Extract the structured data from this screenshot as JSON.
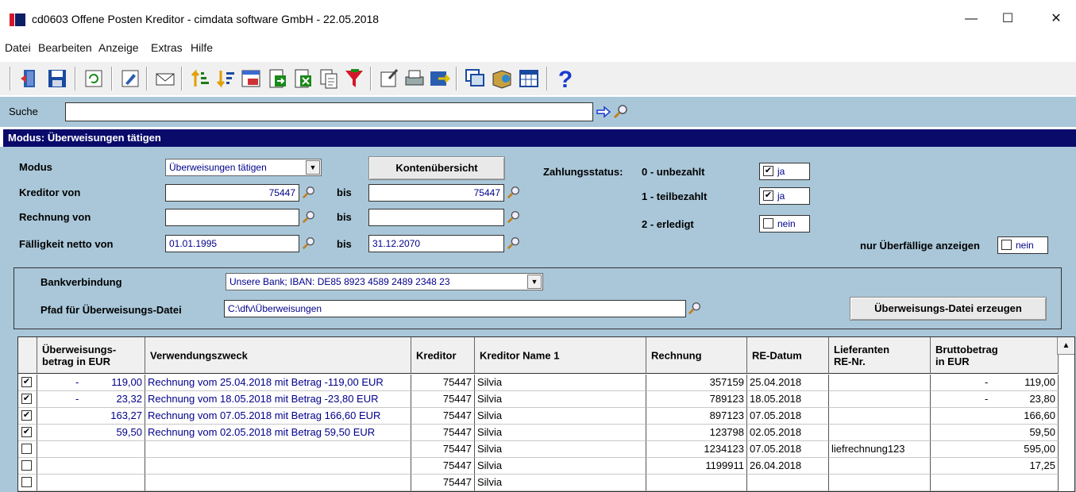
{
  "window": {
    "title": "cd0603 Offene Posten Kreditor - cimdata software GmbH - 22.05.2018",
    "minimize": "—",
    "maximize": "☐",
    "close": "✕"
  },
  "menu": {
    "items": [
      "Datei",
      "Bearbeiten",
      "Anzeige",
      "Extras",
      "Hilfe"
    ]
  },
  "toolbar": {
    "icons": [
      "exit-icon",
      "save-icon",
      "refresh-icon",
      "edit-icon",
      "mail-icon",
      "sort-asc-icon",
      "sort-desc-icon",
      "calendar-icon",
      "export-icon",
      "excel-icon",
      "copy-icon",
      "filter-icon",
      "properties-icon",
      "print-icon",
      "transfer-icon",
      "windows-icon",
      "book-icon",
      "table-icon",
      "help-icon"
    ],
    "help_label": "?"
  },
  "search": {
    "label": "Suche",
    "value": ""
  },
  "mode_header": "Modus: Überweisungen tätigen",
  "form": {
    "modus_label": "Modus",
    "modus_value": "Überweisungen tätigen",
    "kontenuebersicht": "Kontenübersicht",
    "kreditor_label": "Kreditor von",
    "kreditor_from": "75447",
    "kreditor_to": "75447",
    "rechnung_label": "Rechnung von",
    "rechnung_from": "",
    "rechnung_to": "",
    "faelligkeit_label": "Fälligkeit netto von",
    "faelligkeit_from": "01.01.1995",
    "faelligkeit_to": "31.12.2070",
    "bis": "bis",
    "zahlungsstatus_label": "Zahlungsstatus:",
    "status": [
      {
        "label": "0 - unbezahlt",
        "checked": true,
        "value": "ja"
      },
      {
        "label": "1 - teilbezahlt",
        "checked": true,
        "value": "ja"
      },
      {
        "label": "2 - erledigt",
        "checked": false,
        "value": "nein"
      }
    ],
    "ueberfaellige_label": "nur Überfällige anzeigen",
    "ueberfaellige_value": "nein",
    "bank_label": "Bankverbindung",
    "bank_value": "Unsere Bank; IBAN: DE85 8923 4589 2489 2348 23",
    "pfad_label": "Pfad für Überweisungs-Datei",
    "pfad_value": "C:\\dfv\\Überweisungen",
    "erzeugen_button": "Überweisungs-Datei erzeugen"
  },
  "grid": {
    "columns": [
      "Überweisungs-\nbetrag in EUR",
      "Verwendungszweck",
      "Kreditor",
      "Kreditor Name 1",
      "Rechnung",
      "RE-Datum",
      "Lieferanten\nRE-Nr.",
      "Bruttobetrag\nin EUR"
    ],
    "rows": [
      {
        "checked": true,
        "dash": "-",
        "betrag": "119,00",
        "zweck": "Rechnung vom 25.04.2018 mit Betrag -119,00 EUR",
        "kreditor": "75447",
        "name": "Silvia",
        "rechnung": "357159",
        "datum": "25.04.2018",
        "lief": "",
        "brutto_dash": "-",
        "brutto": "119,00"
      },
      {
        "checked": true,
        "dash": "-",
        "betrag": "23,32",
        "zweck": "Rechnung vom 18.05.2018 mit Betrag -23,80 EUR",
        "kreditor": "75447",
        "name": "Silvia",
        "rechnung": "789123",
        "datum": "18.05.2018",
        "lief": "",
        "brutto_dash": "-",
        "brutto": "23,80"
      },
      {
        "checked": true,
        "dash": "",
        "betrag": "163,27",
        "zweck": "Rechnung vom 07.05.2018 mit Betrag 166,60 EUR",
        "kreditor": "75447",
        "name": "Silvia",
        "rechnung": "897123",
        "datum": "07.05.2018",
        "lief": "",
        "brutto_dash": "",
        "brutto": "166,60"
      },
      {
        "checked": true,
        "dash": "",
        "betrag": "59,50",
        "zweck": "Rechnung vom 02.05.2018 mit Betrag 59,50 EUR",
        "kreditor": "75447",
        "name": "Silvia",
        "rechnung": "123798",
        "datum": "02.05.2018",
        "lief": "",
        "brutto_dash": "",
        "brutto": "59,50"
      },
      {
        "checked": false,
        "dash": "",
        "betrag": "",
        "zweck": "",
        "kreditor": "75447",
        "name": "Silvia",
        "rechnung": "1234123",
        "datum": "07.05.2018",
        "lief": "liefrechnung123",
        "brutto_dash": "",
        "brutto": "595,00"
      },
      {
        "checked": false,
        "dash": "",
        "betrag": "",
        "zweck": "",
        "kreditor": "75447",
        "name": "Silvia",
        "rechnung": "1199911",
        "datum": "26.04.2018",
        "lief": "",
        "brutto_dash": "",
        "brutto": "17,25"
      },
      {
        "checked": false,
        "dash": "",
        "betrag": "",
        "zweck": "",
        "kreditor": "75447",
        "name": "Silvia",
        "rechnung": "",
        "datum": "",
        "lief": "",
        "brutto_dash": "",
        "brutto": ""
      }
    ]
  }
}
